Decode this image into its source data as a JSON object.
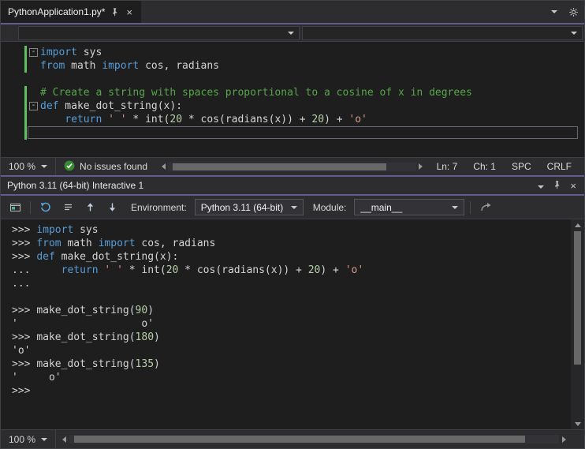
{
  "colors": {
    "accent_purple": "#615c90",
    "keyword_blue": "#569cd6",
    "string_orange": "#d69d85",
    "number_green": "#b5cea8",
    "comment_green": "#57a64a",
    "check_green": "#388a34",
    "change_bar_green": "#5ec05e",
    "editor_background": "#1e1e1e",
    "chrome_background": "#2d2d30"
  },
  "icons": {
    "close": "×",
    "collapse": "-"
  },
  "tab": {
    "title": "PythonApplication1.py*"
  },
  "editor_status": {
    "zoom": "100 %",
    "issues": "No issues found",
    "line": "Ln: 7",
    "column": "Ch: 1",
    "spaces": "SPC",
    "eol": "CRLF"
  },
  "interactive": {
    "title": "Python 3.11 (64-bit) Interactive 1",
    "environment_label": "Environment:",
    "environment_value": "Python 3.11 (64-bit)",
    "module_label": "Module:",
    "module_value": "__main__",
    "zoom": "100 %"
  },
  "editor_lines": [
    {
      "fold": true,
      "chg": true,
      "seg": [
        [
          "kw",
          "import"
        ],
        [
          "pl",
          " sys"
        ]
      ]
    },
    {
      "fold": false,
      "chg": true,
      "seg": [
        [
          "kw",
          "from"
        ],
        [
          "pl",
          " math "
        ],
        [
          "kw",
          "import"
        ],
        [
          "pl",
          " cos, radians"
        ]
      ]
    },
    {
      "fold": false,
      "chg": false,
      "seg": []
    },
    {
      "fold": false,
      "chg": true,
      "seg": [
        [
          "com",
          "# Create a string with spaces proportional to a cosine of x in degrees"
        ]
      ]
    },
    {
      "fold": true,
      "chg": true,
      "seg": [
        [
          "kw",
          "def"
        ],
        [
          "pl",
          " make_dot_string(x):"
        ]
      ]
    },
    {
      "fold": false,
      "chg": true,
      "seg": [
        [
          "pl",
          "    "
        ],
        [
          "kw",
          "return"
        ],
        [
          "pl",
          " "
        ],
        [
          "str",
          "' '"
        ],
        [
          "pl",
          " * int("
        ],
        [
          "num",
          "20"
        ],
        [
          "pl",
          " * cos(radians(x)) + "
        ],
        [
          "num",
          "20"
        ],
        [
          "pl",
          ") + "
        ],
        [
          "str",
          "'o'"
        ]
      ]
    },
    {
      "fold": false,
      "chg": true,
      "box": true,
      "seg": []
    }
  ],
  "console_lines": [
    {
      "seg": [
        [
          "pr",
          ">>> "
        ],
        [
          "kw",
          "import"
        ],
        [
          "pl",
          " sys"
        ]
      ]
    },
    {
      "seg": [
        [
          "pr",
          ">>> "
        ],
        [
          "kw",
          "from"
        ],
        [
          "pl",
          " math "
        ],
        [
          "kw",
          "import"
        ],
        [
          "pl",
          " cos, radians"
        ]
      ]
    },
    {
      "seg": [
        [
          "pr",
          ">>> "
        ],
        [
          "kw",
          "def"
        ],
        [
          "pl",
          " make_dot_string(x):"
        ]
      ]
    },
    {
      "seg": [
        [
          "pr",
          "... "
        ],
        [
          "pl",
          "    "
        ],
        [
          "kw",
          "return"
        ],
        [
          "pl",
          " "
        ],
        [
          "str",
          "' '"
        ],
        [
          "pl",
          " * int("
        ],
        [
          "num",
          "20"
        ],
        [
          "pl",
          " * cos(radians(x)) + "
        ],
        [
          "num",
          "20"
        ],
        [
          "pl",
          ") + "
        ],
        [
          "str",
          "'o'"
        ]
      ]
    },
    {
      "seg": [
        [
          "pr",
          "..."
        ]
      ]
    },
    {
      "seg": []
    },
    {
      "seg": [
        [
          "pr",
          ">>> "
        ],
        [
          "pl",
          "make_dot_string("
        ],
        [
          "num",
          "90"
        ],
        [
          "pl",
          ")"
        ]
      ]
    },
    {
      "seg": [
        [
          "out",
          "'                    o'"
        ]
      ]
    },
    {
      "seg": [
        [
          "pr",
          ">>> "
        ],
        [
          "pl",
          "make_dot_string("
        ],
        [
          "num",
          "180"
        ],
        [
          "pl",
          ")"
        ]
      ]
    },
    {
      "seg": [
        [
          "out",
          "'o'"
        ]
      ]
    },
    {
      "seg": [
        [
          "pr",
          ">>> "
        ],
        [
          "pl",
          "make_dot_string("
        ],
        [
          "num",
          "135"
        ],
        [
          "pl",
          ")"
        ]
      ]
    },
    {
      "seg": [
        [
          "out",
          "'     o'"
        ]
      ]
    },
    {
      "seg": [
        [
          "pr",
          ">>> "
        ]
      ]
    }
  ]
}
